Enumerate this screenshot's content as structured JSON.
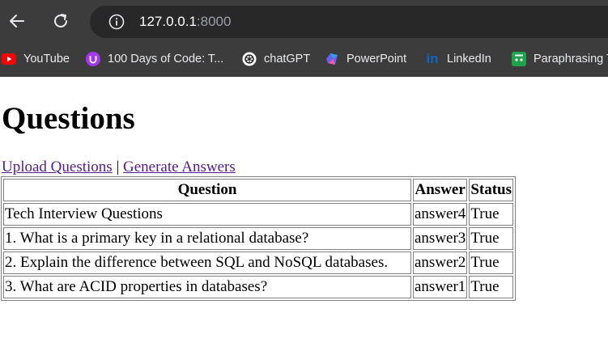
{
  "browser": {
    "url_host": "127.0.0.1",
    "url_port": ":8000",
    "bookmarks": [
      {
        "label": "YouTube",
        "icon": "youtube-icon"
      },
      {
        "label": "100 Days of Code: T...",
        "icon": "udemy-icon"
      },
      {
        "label": "chatGPT",
        "icon": "openai-icon"
      },
      {
        "label": "PowerPoint",
        "icon": "copilot-icon"
      },
      {
        "label": "LinkedIn",
        "icon": "linkedin-icon"
      },
      {
        "label": "Paraphrasing T",
        "icon": "paraphrasing-icon"
      }
    ]
  },
  "page": {
    "title": "Questions",
    "links": {
      "upload": "Upload Questions",
      "separator": "|",
      "generate": "Generate Answers"
    },
    "table": {
      "headers": [
        "Question",
        "Answer",
        "Status"
      ],
      "rows": [
        [
          "Tech Interview Questions",
          "answer4",
          "True"
        ],
        [
          "1. What is a primary key in a relational database?",
          "answer3",
          "True"
        ],
        [
          "2. Explain the difference between SQL and NoSQL databases.",
          "answer2",
          "True"
        ],
        [
          "3. What are ACID properties in databases?",
          "answer1",
          "True"
        ]
      ]
    }
  }
}
